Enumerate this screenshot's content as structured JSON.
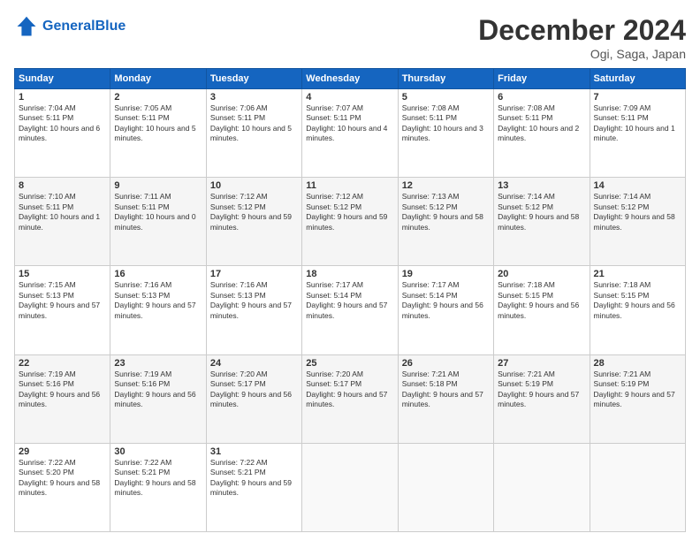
{
  "logo": {
    "line1": "General",
    "line2": "Blue"
  },
  "title": "December 2024",
  "location": "Ogi, Saga, Japan",
  "headers": [
    "Sunday",
    "Monday",
    "Tuesday",
    "Wednesday",
    "Thursday",
    "Friday",
    "Saturday"
  ],
  "weeks": [
    [
      {
        "day": "1",
        "sunrise": "7:04 AM",
        "sunset": "5:11 PM",
        "daylight": "10 hours and 6 minutes."
      },
      {
        "day": "2",
        "sunrise": "7:05 AM",
        "sunset": "5:11 PM",
        "daylight": "10 hours and 5 minutes."
      },
      {
        "day": "3",
        "sunrise": "7:06 AM",
        "sunset": "5:11 PM",
        "daylight": "10 hours and 5 minutes."
      },
      {
        "day": "4",
        "sunrise": "7:07 AM",
        "sunset": "5:11 PM",
        "daylight": "10 hours and 4 minutes."
      },
      {
        "day": "5",
        "sunrise": "7:08 AM",
        "sunset": "5:11 PM",
        "daylight": "10 hours and 3 minutes."
      },
      {
        "day": "6",
        "sunrise": "7:08 AM",
        "sunset": "5:11 PM",
        "daylight": "10 hours and 2 minutes."
      },
      {
        "day": "7",
        "sunrise": "7:09 AM",
        "sunset": "5:11 PM",
        "daylight": "10 hours and 1 minute."
      }
    ],
    [
      {
        "day": "8",
        "sunrise": "7:10 AM",
        "sunset": "5:11 PM",
        "daylight": "10 hours and 1 minute."
      },
      {
        "day": "9",
        "sunrise": "7:11 AM",
        "sunset": "5:11 PM",
        "daylight": "10 hours and 0 minutes."
      },
      {
        "day": "10",
        "sunrise": "7:12 AM",
        "sunset": "5:12 PM",
        "daylight": "9 hours and 59 minutes."
      },
      {
        "day": "11",
        "sunrise": "7:12 AM",
        "sunset": "5:12 PM",
        "daylight": "9 hours and 59 minutes."
      },
      {
        "day": "12",
        "sunrise": "7:13 AM",
        "sunset": "5:12 PM",
        "daylight": "9 hours and 58 minutes."
      },
      {
        "day": "13",
        "sunrise": "7:14 AM",
        "sunset": "5:12 PM",
        "daylight": "9 hours and 58 minutes."
      },
      {
        "day": "14",
        "sunrise": "7:14 AM",
        "sunset": "5:12 PM",
        "daylight": "9 hours and 58 minutes."
      }
    ],
    [
      {
        "day": "15",
        "sunrise": "7:15 AM",
        "sunset": "5:13 PM",
        "daylight": "9 hours and 57 minutes."
      },
      {
        "day": "16",
        "sunrise": "7:16 AM",
        "sunset": "5:13 PM",
        "daylight": "9 hours and 57 minutes."
      },
      {
        "day": "17",
        "sunrise": "7:16 AM",
        "sunset": "5:13 PM",
        "daylight": "9 hours and 57 minutes."
      },
      {
        "day": "18",
        "sunrise": "7:17 AM",
        "sunset": "5:14 PM",
        "daylight": "9 hours and 57 minutes."
      },
      {
        "day": "19",
        "sunrise": "7:17 AM",
        "sunset": "5:14 PM",
        "daylight": "9 hours and 56 minutes."
      },
      {
        "day": "20",
        "sunrise": "7:18 AM",
        "sunset": "5:15 PM",
        "daylight": "9 hours and 56 minutes."
      },
      {
        "day": "21",
        "sunrise": "7:18 AM",
        "sunset": "5:15 PM",
        "daylight": "9 hours and 56 minutes."
      }
    ],
    [
      {
        "day": "22",
        "sunrise": "7:19 AM",
        "sunset": "5:16 PM",
        "daylight": "9 hours and 56 minutes."
      },
      {
        "day": "23",
        "sunrise": "7:19 AM",
        "sunset": "5:16 PM",
        "daylight": "9 hours and 56 minutes."
      },
      {
        "day": "24",
        "sunrise": "7:20 AM",
        "sunset": "5:17 PM",
        "daylight": "9 hours and 56 minutes."
      },
      {
        "day": "25",
        "sunrise": "7:20 AM",
        "sunset": "5:17 PM",
        "daylight": "9 hours and 57 minutes."
      },
      {
        "day": "26",
        "sunrise": "7:21 AM",
        "sunset": "5:18 PM",
        "daylight": "9 hours and 57 minutes."
      },
      {
        "day": "27",
        "sunrise": "7:21 AM",
        "sunset": "5:19 PM",
        "daylight": "9 hours and 57 minutes."
      },
      {
        "day": "28",
        "sunrise": "7:21 AM",
        "sunset": "5:19 PM",
        "daylight": "9 hours and 57 minutes."
      }
    ],
    [
      {
        "day": "29",
        "sunrise": "7:22 AM",
        "sunset": "5:20 PM",
        "daylight": "9 hours and 58 minutes."
      },
      {
        "day": "30",
        "sunrise": "7:22 AM",
        "sunset": "5:21 PM",
        "daylight": "9 hours and 58 minutes."
      },
      {
        "day": "31",
        "sunrise": "7:22 AM",
        "sunset": "5:21 PM",
        "daylight": "9 hours and 59 minutes."
      },
      null,
      null,
      null,
      null
    ]
  ]
}
